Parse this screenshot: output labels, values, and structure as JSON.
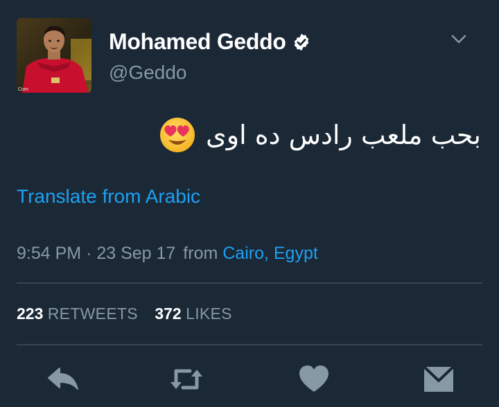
{
  "user": {
    "display_name": "Mohamed Geddo",
    "handle": "@Geddo",
    "verified": true,
    "verified_icon": "verified-badge-icon",
    "avatar_watermark": "Com"
  },
  "tweet": {
    "text": "بحب ملعب رادس ده اوى",
    "emoji": "smiling-face-with-heart-eyes-emoji",
    "translate_label": "Translate from Arabic",
    "time": "9:54 PM",
    "separator": "·",
    "date": "23 Sep 17",
    "from_label": "from",
    "location": "Cairo, Egypt"
  },
  "stats": {
    "retweets_count": "223",
    "retweets_label": "RETWEETS",
    "likes_count": "372",
    "likes_label": "LIKES"
  },
  "actions": [
    "reply-icon",
    "retweet-icon",
    "like-icon",
    "direct-message-icon"
  ],
  "colors": {
    "background": "#1b2836",
    "link": "#1da1f2",
    "secondary_text": "#8899a6",
    "divider": "#38444d",
    "icon": "#8899a6"
  }
}
